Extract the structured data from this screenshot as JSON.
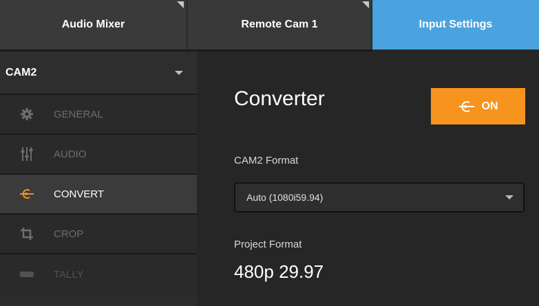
{
  "tabs": [
    {
      "label": "Audio Mixer"
    },
    {
      "label": "Remote Cam 1"
    },
    {
      "label": "Input Settings"
    }
  ],
  "colors": {
    "accent": "#f7941e",
    "active_tab": "#4aa3df"
  },
  "sidebar": {
    "source_select": {
      "value": "CAM2"
    },
    "items": [
      {
        "label": "GENERAL",
        "icon": "gear-icon"
      },
      {
        "label": "AUDIO",
        "icon": "sliders-icon"
      },
      {
        "label": "CONVERT",
        "icon": "convert-icon"
      },
      {
        "label": "CROP",
        "icon": "crop-icon"
      },
      {
        "label": "TALLY",
        "icon": "tally-icon"
      }
    ]
  },
  "main": {
    "title": "Converter",
    "toggle_label": "ON",
    "format_label": "CAM2 Format",
    "format_value": "Auto (1080i59.94)",
    "project_label": "Project Format",
    "project_value": "480p 29.97"
  }
}
